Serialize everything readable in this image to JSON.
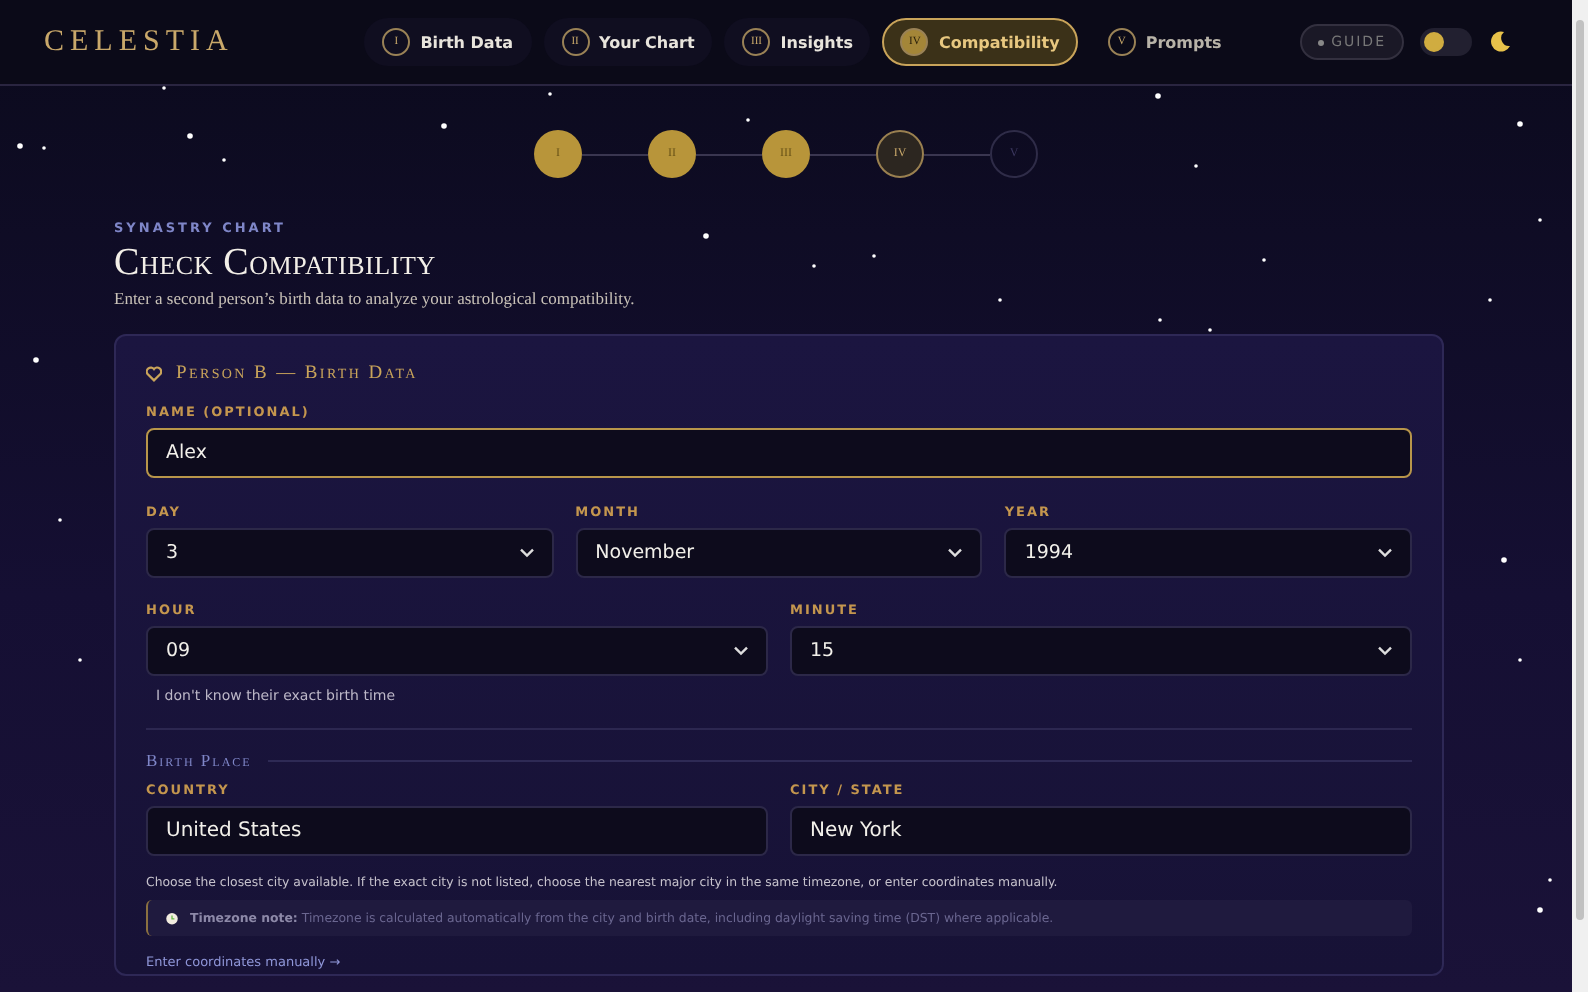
{
  "brand": "CELESTIA",
  "nav": [
    {
      "numeral": "I",
      "label": "Birth Data",
      "selected": false
    },
    {
      "numeral": "II",
      "label": "Your Chart",
      "selected": false
    },
    {
      "numeral": "III",
      "label": "Insights",
      "selected": false
    },
    {
      "numeral": "IV",
      "label": "Compatibility",
      "selected": true
    },
    {
      "numeral": "V",
      "label": "Prompts",
      "selected": false
    }
  ],
  "guide_button": "GUIDE",
  "theme_toggle": {
    "on": false
  },
  "steps": [
    {
      "numeral": "I",
      "kind": "done"
    },
    {
      "numeral": "II",
      "kind": "done"
    },
    {
      "numeral": "III",
      "kind": "done"
    },
    {
      "numeral": "IV",
      "kind": "current"
    },
    {
      "numeral": "V",
      "kind": "upcoming"
    }
  ],
  "eyebrow": "SYNASTRY CHART",
  "title": "Check Compatibility",
  "subtitle": "Enter a second person’s birth data to analyze your astrological compatibility.",
  "card": {
    "heading": "Person B — Birth Data",
    "name_field": {
      "label": "NAME (OPTIONAL)",
      "value": "Alex"
    },
    "date_fields": [
      {
        "label": "DAY",
        "value": "3"
      },
      {
        "label": "MONTH",
        "value": "November"
      },
      {
        "label": "YEAR",
        "value": "1994"
      }
    ],
    "time_fields": [
      {
        "label": "HOUR",
        "value": "09"
      },
      {
        "label": "MINUTE",
        "value": "15"
      }
    ],
    "unknown_time": "I don't know their exact birth time",
    "place_heading": "Birth Place",
    "place_fields": [
      {
        "label": "COUNTRY",
        "value": "United States"
      },
      {
        "label": "CITY / STATE",
        "value": "New York"
      }
    ],
    "help": "Choose the closest city available. If the exact city is not listed, choose the nearest major city in the same timezone, or enter coordinates manually.",
    "timezone_note": "**Timezone note:** Timezone is calculated automatically from the city and birth date, including daylight saving time (DST) where applicable.",
    "manual_link": "Enter coordinates manually →"
  }
}
